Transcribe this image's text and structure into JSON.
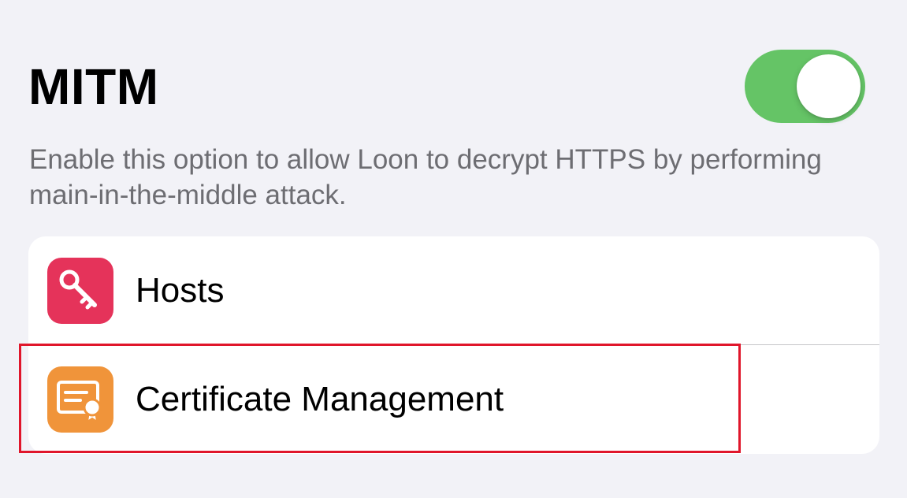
{
  "header": {
    "title": "MITM"
  },
  "toggle": {
    "state": "on",
    "color": "#65c466"
  },
  "description": "Enable this option to allow Loon to decrypt HTTPS by performing main-in-the-middle attack.",
  "list": {
    "items": [
      {
        "label": "Hosts",
        "icon": "key-icon",
        "icon_color": "#e5335a"
      },
      {
        "label": "Certificate Management",
        "icon": "certificate-icon",
        "icon_color": "#f0943a"
      }
    ]
  },
  "highlight": {
    "target": "Certificate Management",
    "color": "#e0162b"
  }
}
